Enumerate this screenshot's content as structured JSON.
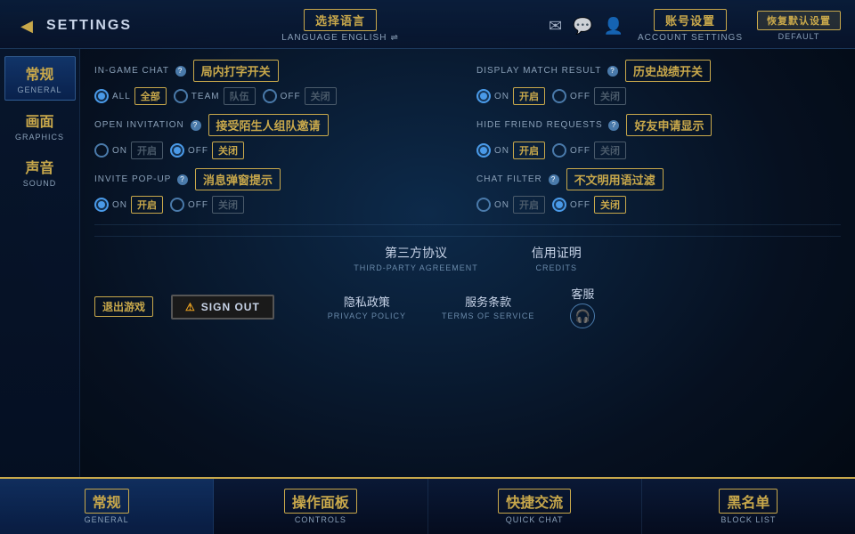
{
  "header": {
    "back_label": "◀",
    "title": "SETTINGS",
    "language_zh": "选择语言",
    "language_en": "LANGUAGE ENGLISH",
    "language_icon": "⇌",
    "account_zh": "账号设置",
    "account_en": "ACCOUNT SETTINGS",
    "default_zh": "恢复默认设置",
    "default_en": "DEFAULT",
    "icons": {
      "mail": "✉",
      "chat": "💬",
      "profile": "👤"
    }
  },
  "sidebar": {
    "items": [
      {
        "zh": "常规",
        "en": "GENERAL",
        "active": true
      },
      {
        "zh": "画面",
        "en": "GRAPHICS",
        "active": false
      },
      {
        "zh": "声音",
        "en": "SOUND",
        "active": false
      }
    ]
  },
  "settings": {
    "ingame_chat": {
      "label_en": "IN-GAME CHAT",
      "label_zh": "局内打字开关",
      "options": [
        {
          "value": "ALL",
          "zh": "全部",
          "selected": true
        },
        {
          "value": "TEAM",
          "zh": "队伍",
          "selected": false
        },
        {
          "value": "OFF",
          "zh": "关闭",
          "selected": false
        }
      ]
    },
    "display_match": {
      "label_en": "DISPLAY MATCH RESULT",
      "label_zh": "历史战绩开关",
      "options": [
        {
          "value": "ON",
          "zh": "开启",
          "selected": true
        },
        {
          "value": "OFF",
          "zh": "关闭",
          "selected": false
        }
      ]
    },
    "open_invitation": {
      "label_en": "OPEN INVITATION",
      "label_zh": "接受陌生人组队邀请",
      "options": [
        {
          "value": "ON",
          "zh": "开启",
          "selected": false
        },
        {
          "value": "OFF",
          "zh": "关闭",
          "selected": true
        }
      ]
    },
    "hide_friend": {
      "label_en": "HIDE FRIEND REQUESTS",
      "label_zh": "好友申请显示",
      "options": [
        {
          "value": "ON",
          "zh": "开启",
          "selected": true
        },
        {
          "value": "OFF",
          "zh": "关闭",
          "selected": false
        }
      ]
    },
    "invite_popup": {
      "label_en": "INVITE POP-UP",
      "label_zh": "消息弹窗提示",
      "options": [
        {
          "value": "ON",
          "zh": "开启",
          "selected": true
        },
        {
          "value": "OFF",
          "zh": "关闭",
          "selected": false
        }
      ]
    },
    "chat_filter": {
      "label_en": "CHAT FILTER",
      "label_zh": "不文明用语过滤",
      "options": [
        {
          "value": "ON",
          "zh": "开启",
          "selected": false
        },
        {
          "value": "OFF",
          "zh": "关闭",
          "selected": true
        }
      ]
    }
  },
  "links": {
    "third_party_zh": "第三方协议",
    "third_party_en": "THIRD-PARTY AGREEMENT",
    "credits_zh": "信用证明",
    "credits_en": "CREDITS"
  },
  "signout": {
    "label_zh": "退出游戏",
    "label_en": "SIGN OUT",
    "warning": "⚠",
    "privacy_zh": "隐私政策",
    "privacy_en": "PRIVACY POLICY",
    "terms_zh": "服务条款",
    "terms_en": "TERMS OF SERVICE",
    "support_zh": "客服",
    "support_icon": "🎧"
  },
  "bottom_tabs": [
    {
      "zh": "常规",
      "en": "GENERAL",
      "active": true
    },
    {
      "zh": "操作面板",
      "en": "CONTROLS",
      "active": false
    },
    {
      "zh": "快捷交流",
      "en": "QUICK CHAT",
      "active": false
    },
    {
      "zh": "黑名单",
      "en": "BLOCK LIST",
      "active": false
    }
  ]
}
